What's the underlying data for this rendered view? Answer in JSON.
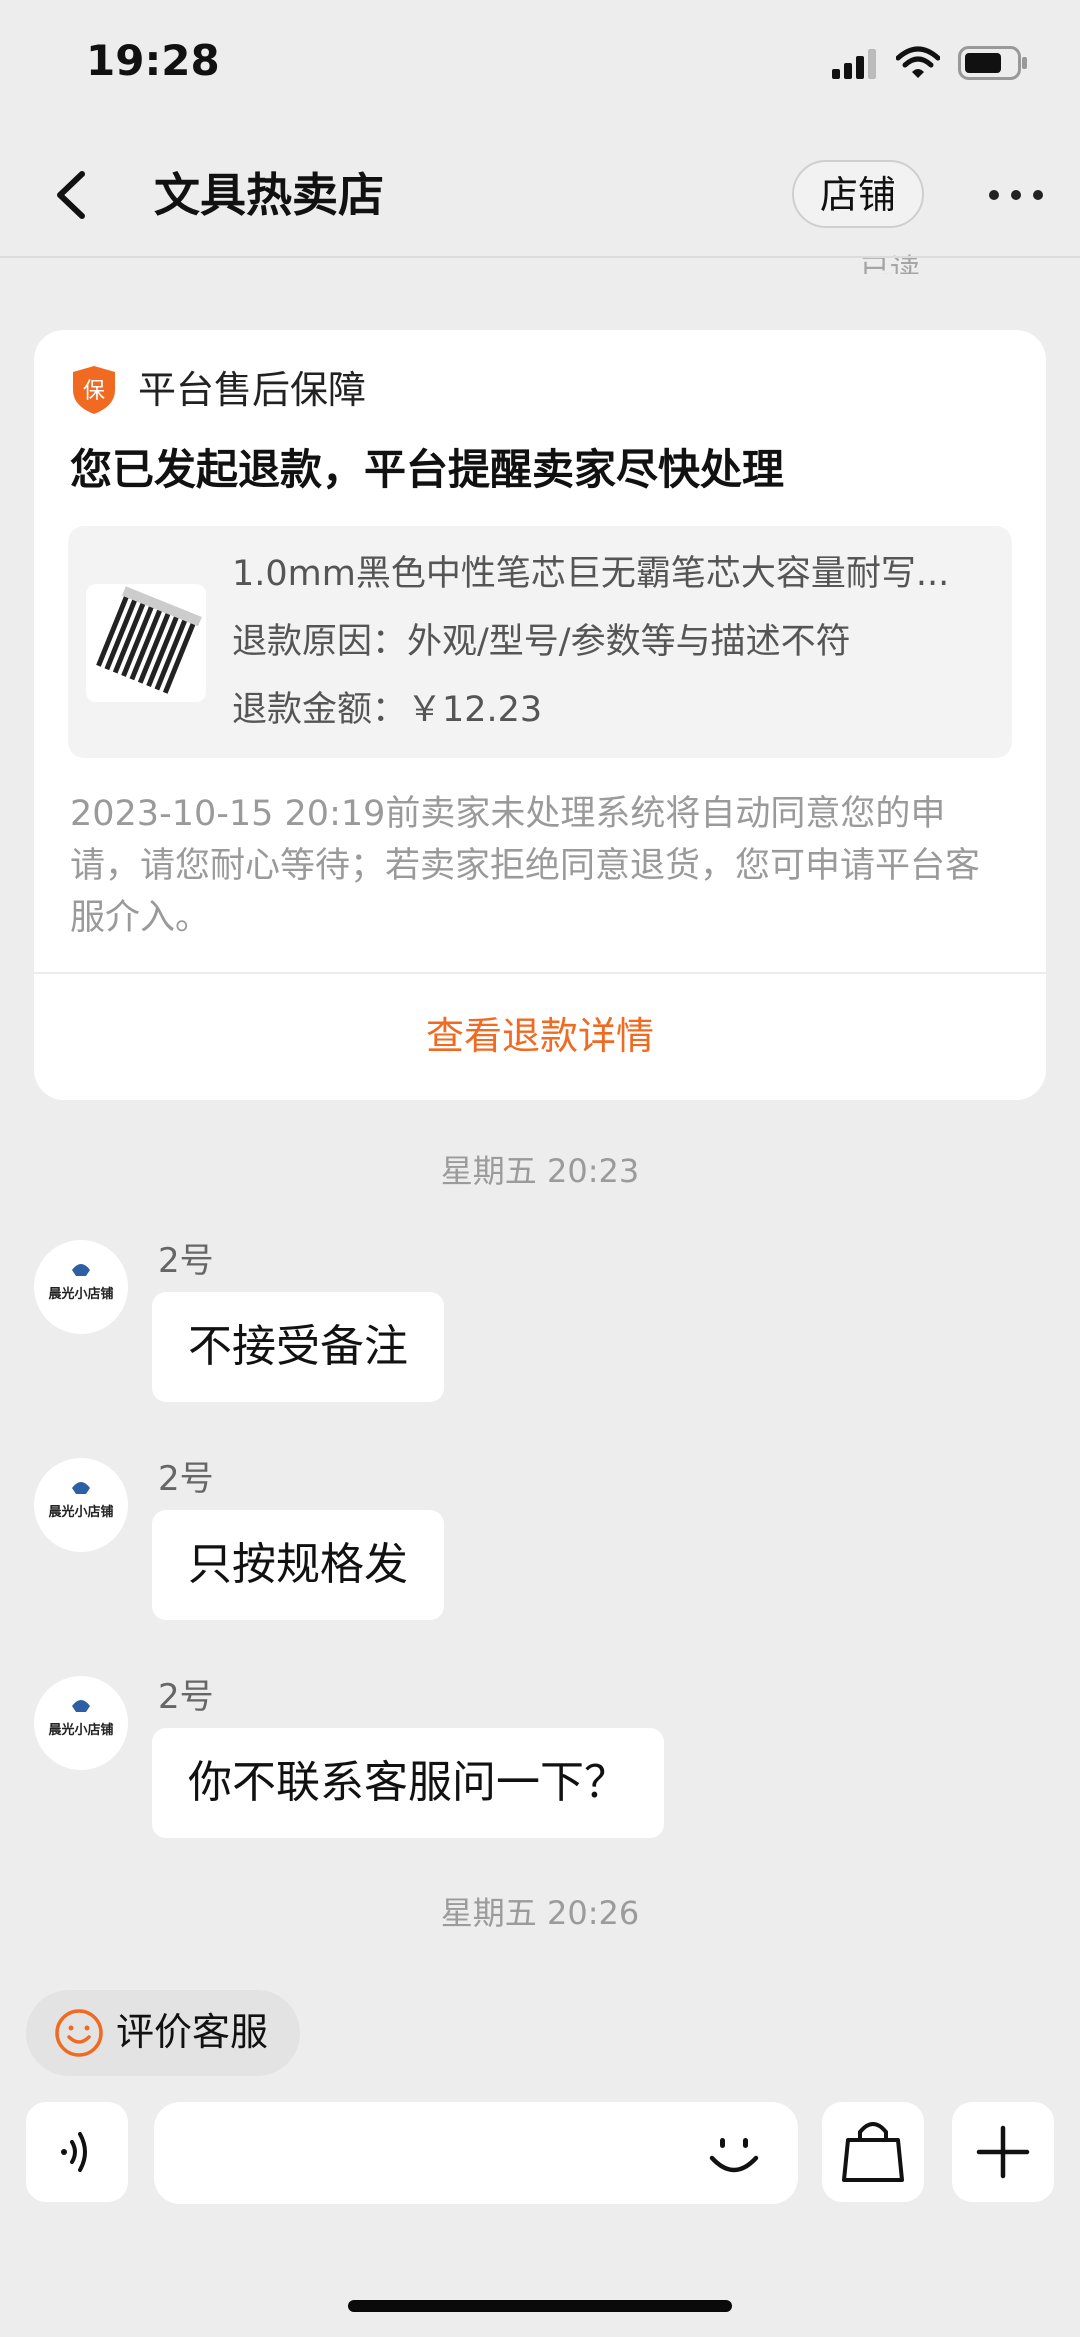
{
  "status_bar": {
    "time": "19:28",
    "icons": [
      "signal-icon",
      "wifi-icon",
      "battery-icon"
    ]
  },
  "nav": {
    "title": "文具热卖店",
    "shop_button": "店铺",
    "back_icon": "chevron-left-icon",
    "more_icon": "more-dots-icon"
  },
  "read_status": "已读",
  "refund_card": {
    "tag": "平台售后保障",
    "shield_glyph": "保",
    "title": "您已发起退款，平台提醒卖家尽快处理",
    "product_name": "1.0mm黑色中性笔芯巨无霸笔芯大容量耐写...",
    "refund_reason": "退款原因：外观/型号/参数等与描述不符",
    "refund_amount": "退款金额：￥12.23",
    "note": "2023-10-15 20:19前卖家未处理系统将自动同意您的申请，请您耐心等待；若卖家拒绝同意退货，您可申请平台客服介入。",
    "link": "查看退款详情",
    "accent_color": "#f06a22"
  },
  "timestamps": [
    "星期五 20:23",
    "星期五 20:26"
  ],
  "messages": [
    {
      "sender": "2号",
      "text": "不接受备注",
      "avatar_text": "晨光小店铺"
    },
    {
      "sender": "2号",
      "text": "只按规格发",
      "avatar_text": "晨光小店铺"
    },
    {
      "sender": "2号",
      "text": "你不联系客服问一下？",
      "avatar_text": "晨光小店铺"
    }
  ],
  "rate_button": {
    "label": "评价客服",
    "icon": "smiley-icon"
  },
  "input_bar": {
    "placeholder": "",
    "icons": [
      "voice-icon",
      "emoji-icon",
      "shopping-bag-icon",
      "plus-icon"
    ]
  }
}
